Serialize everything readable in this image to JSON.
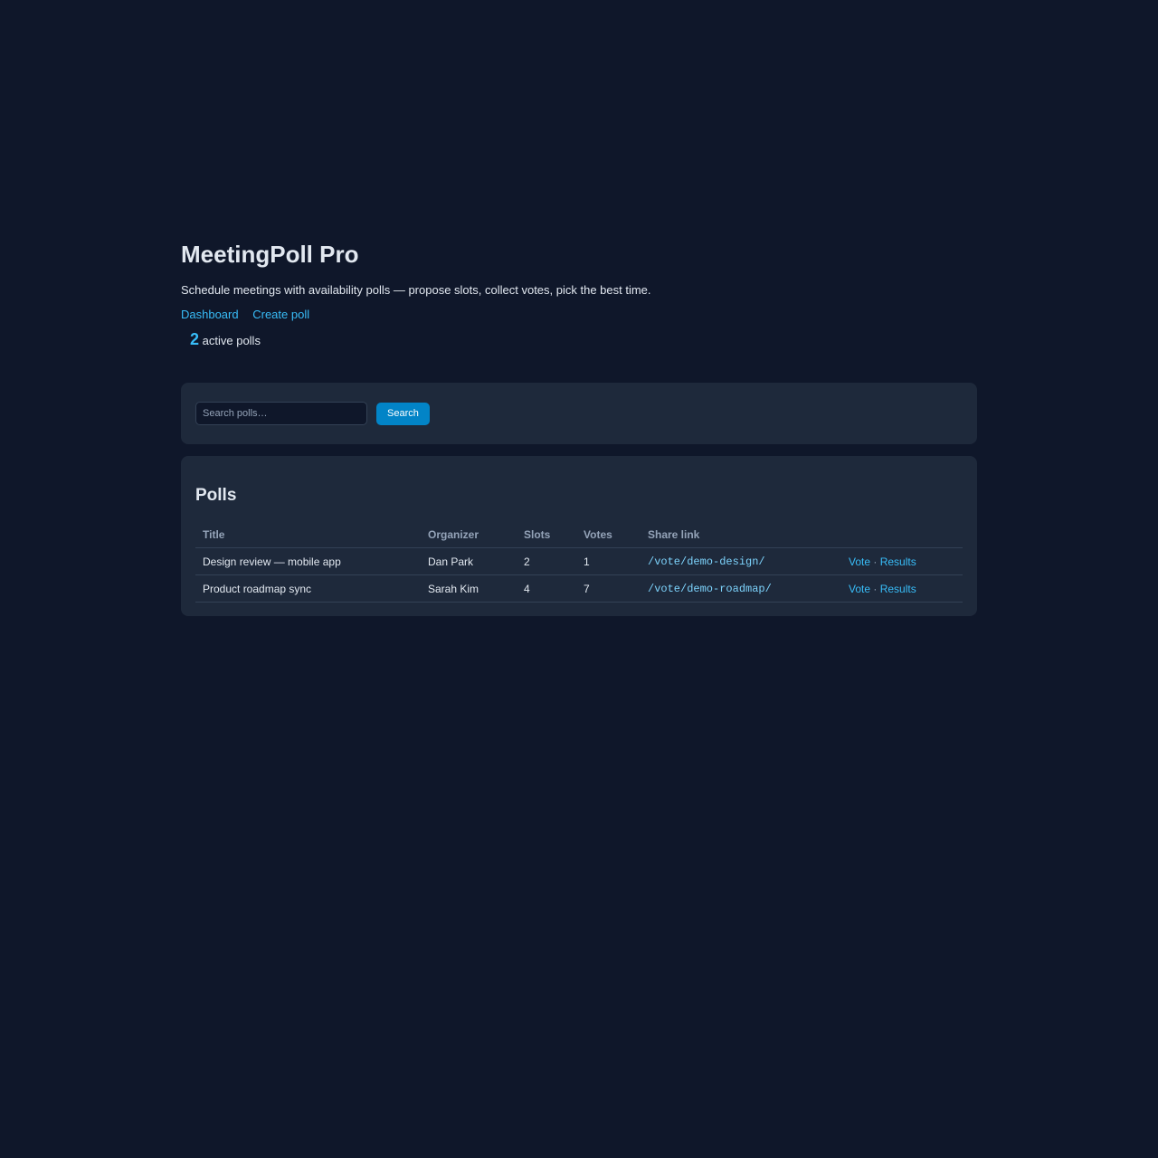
{
  "app": {
    "title": "MeetingPoll Pro",
    "subtitle": "Schedule meetings with availability polls — propose slots, collect votes, pick the best time."
  },
  "nav": {
    "dashboard": "Dashboard",
    "create_poll": "Create poll"
  },
  "stats": {
    "active_count": "2",
    "active_label": "active polls"
  },
  "search": {
    "placeholder": "Search polls…",
    "button_label": "Search"
  },
  "polls": {
    "heading": "Polls",
    "columns": [
      "Title",
      "Organizer",
      "Slots",
      "Votes",
      "Share link",
      ""
    ],
    "rows": [
      {
        "title": "Design review — mobile app",
        "organizer": "Dan Park",
        "slots": "2",
        "votes": "1",
        "share_link": "/vote/demo-design/",
        "vote_label": "Vote",
        "separator": "·",
        "results_label": "Results"
      },
      {
        "title": "Product roadmap sync",
        "organizer": "Sarah Kim",
        "slots": "4",
        "votes": "7",
        "share_link": "/vote/demo-roadmap/",
        "vote_label": "Vote",
        "separator": "·",
        "results_label": "Results"
      }
    ]
  },
  "colors": {
    "background": "#0f172a",
    "card": "#1e293b",
    "accent": "#38bdf8",
    "button": "#0284c7"
  }
}
